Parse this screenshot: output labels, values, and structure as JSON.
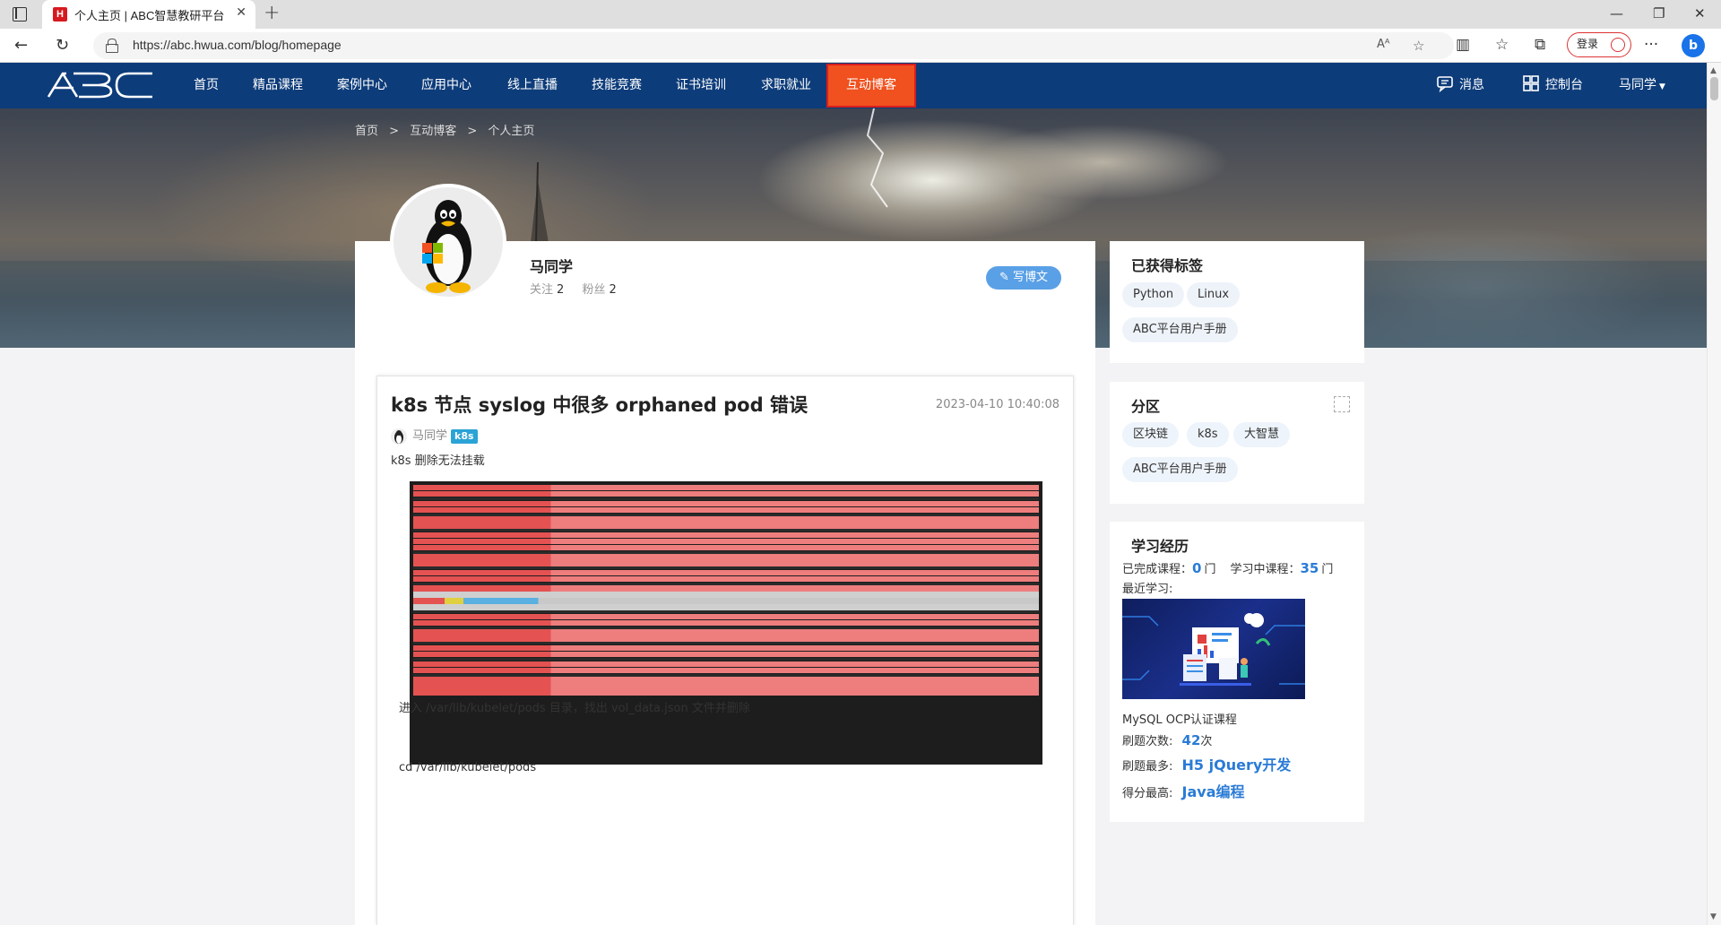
{
  "browser": {
    "tab_title": "个人主页 | ABC智慧教研平台",
    "favicon_text": "H",
    "url": "https://abc.hwua.com/blog/homepage",
    "login_label": "登录"
  },
  "site": {
    "logo_text": "ABC",
    "nav": [
      {
        "label": "首页"
      },
      {
        "label": "精品课程"
      },
      {
        "label": "案例中心"
      },
      {
        "label": "应用中心"
      },
      {
        "label": "线上直播"
      },
      {
        "label": "技能竞赛"
      },
      {
        "label": "证书培训"
      },
      {
        "label": "求职就业"
      },
      {
        "label": "互动博客",
        "active": true
      }
    ],
    "messages_label": "消息",
    "console_label": "控制台",
    "user_label": "马同学"
  },
  "breadcrumb": [
    "首页",
    "互动博客",
    "个人主页"
  ],
  "breadcrumb_sep": ">",
  "profile": {
    "name": "马同学",
    "follow_label": "关注",
    "follow_count": "2",
    "fans_label": "粉丝",
    "fans_count": "2",
    "write_label": "写博文"
  },
  "post": {
    "title": "k8s 节点 syslog 中很多 orphaned pod 错误",
    "date": "2023-04-10 10:40:08",
    "author": "马同学",
    "tag": "k8s",
    "desc": "k8s 删除无法挂载",
    "para1": "进入 /var/lib/kubelet/pods 目录，找出 vol_data.json 文件并删除",
    "para2": "cd /var/lib/kubelet/pods"
  },
  "sidebar": {
    "tags_title": "已获得标签",
    "tags": [
      "Python",
      "Linux",
      "ABC平台用户手册"
    ],
    "partition_title": "分区",
    "partitions": [
      "区块链",
      "k8s",
      "大智慧",
      "ABC平台用户手册"
    ],
    "study_title": "学习经历",
    "completed_label": "已完成课程：",
    "completed_value": "0",
    "learning_label": "学习中课程：",
    "learning_value": "35",
    "unit": "门",
    "recent_label": "最近学习:",
    "recent_course": "MySQL OCP认证课程",
    "practice_label": "刷题次数:",
    "practice_value": "42",
    "practice_unit": "次",
    "most_label": "刷题最多:",
    "most_value": "H5 jQuery开发",
    "best_label": "得分最高:",
    "best_value": "Java编程"
  },
  "colors": {
    "nav_bg": "#0d3c7a",
    "nav_active": "#f0511e",
    "accent": "#2a7bd6"
  }
}
